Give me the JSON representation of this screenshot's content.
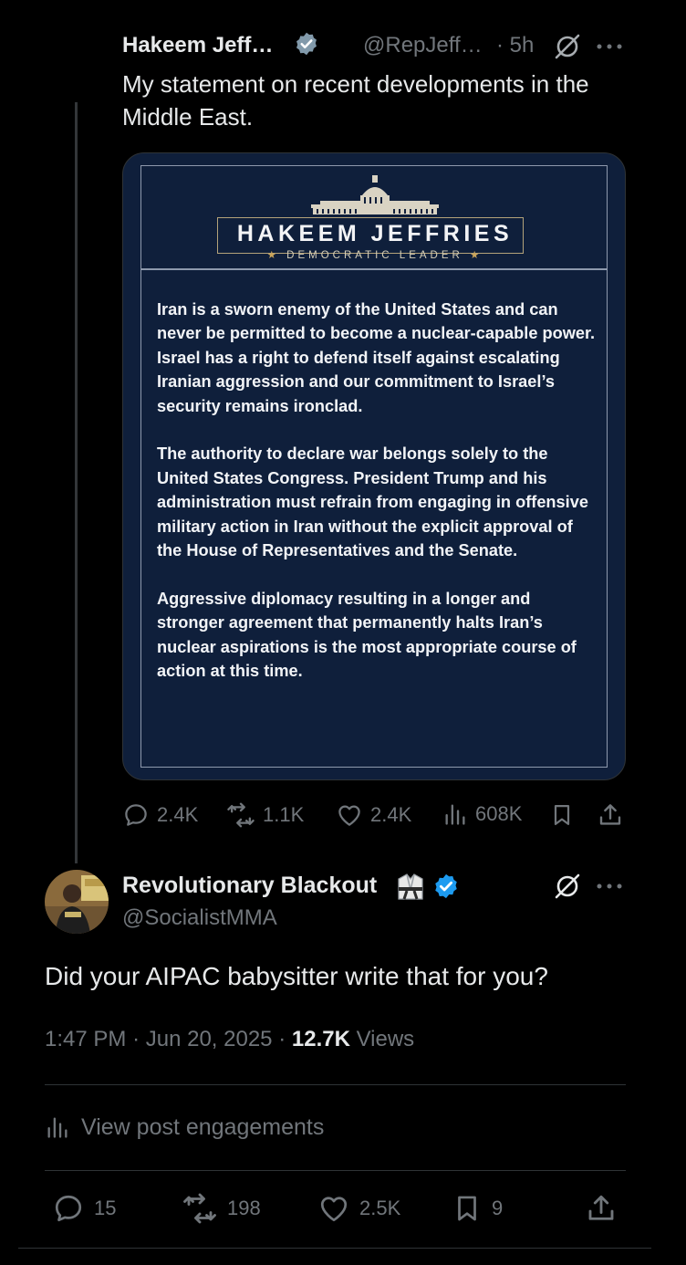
{
  "tweet": {
    "author_name": "Hakeem Jeff…",
    "handle": "@RepJeff…",
    "time": "· 5h",
    "text": "My statement on recent developments in the Middle East.",
    "image": {
      "name": "HAKEEM JEFFRIES",
      "role": "DEMOCRATIC LEADER",
      "paragraphs": [
        "Iran is a sworn enemy of the United States and can never be permitted to become a nuclear-capable power. Israel has a right to defend itself against escalating Iranian aggression and our commitment to Israel’s security remains ironclad.",
        "The authority to declare war belongs solely to the United States Congress. President Trump and his administration must refrain from engaging in offensive military action in Iran without the explicit approval of the House of Representatives and the Senate.",
        "Aggressive diplomacy resulting in a longer and stronger agreement that permanently halts Iran’s nuclear aspirations is the most appropriate course of action at this time."
      ]
    },
    "stats": {
      "replies": "2.4K",
      "reposts": "1.1K",
      "likes": "2.4K",
      "views": "608K"
    }
  },
  "reply": {
    "author_name": "Revolutionary Blackout",
    "handle": "@SocialistMMA",
    "text": "Did your AIPAC babysitter write that for you?",
    "time": "1:47 PM",
    "date": "Jun 20, 2025",
    "views_count": "12.7K",
    "views_label": "Views",
    "engagements_label": "View post engagements",
    "stats": {
      "replies": "15",
      "reposts": "198",
      "likes": "2.5K",
      "bookmarks": "9"
    }
  },
  "colors": {
    "background": "#000000",
    "text_primary": "#e7e9ea",
    "text_secondary": "#71767b",
    "verified_gray": "#829aab",
    "verified_blue": "#1d9bf0",
    "card_navy": "#0f1f3b"
  },
  "icons": [
    "verified-badge-icon",
    "grok-icon",
    "more-icon",
    "reply-icon",
    "repost-icon",
    "like-icon",
    "views-icon",
    "bookmark-icon",
    "share-icon",
    "martial-arts-uniform-emoji",
    "capitol-icon"
  ]
}
